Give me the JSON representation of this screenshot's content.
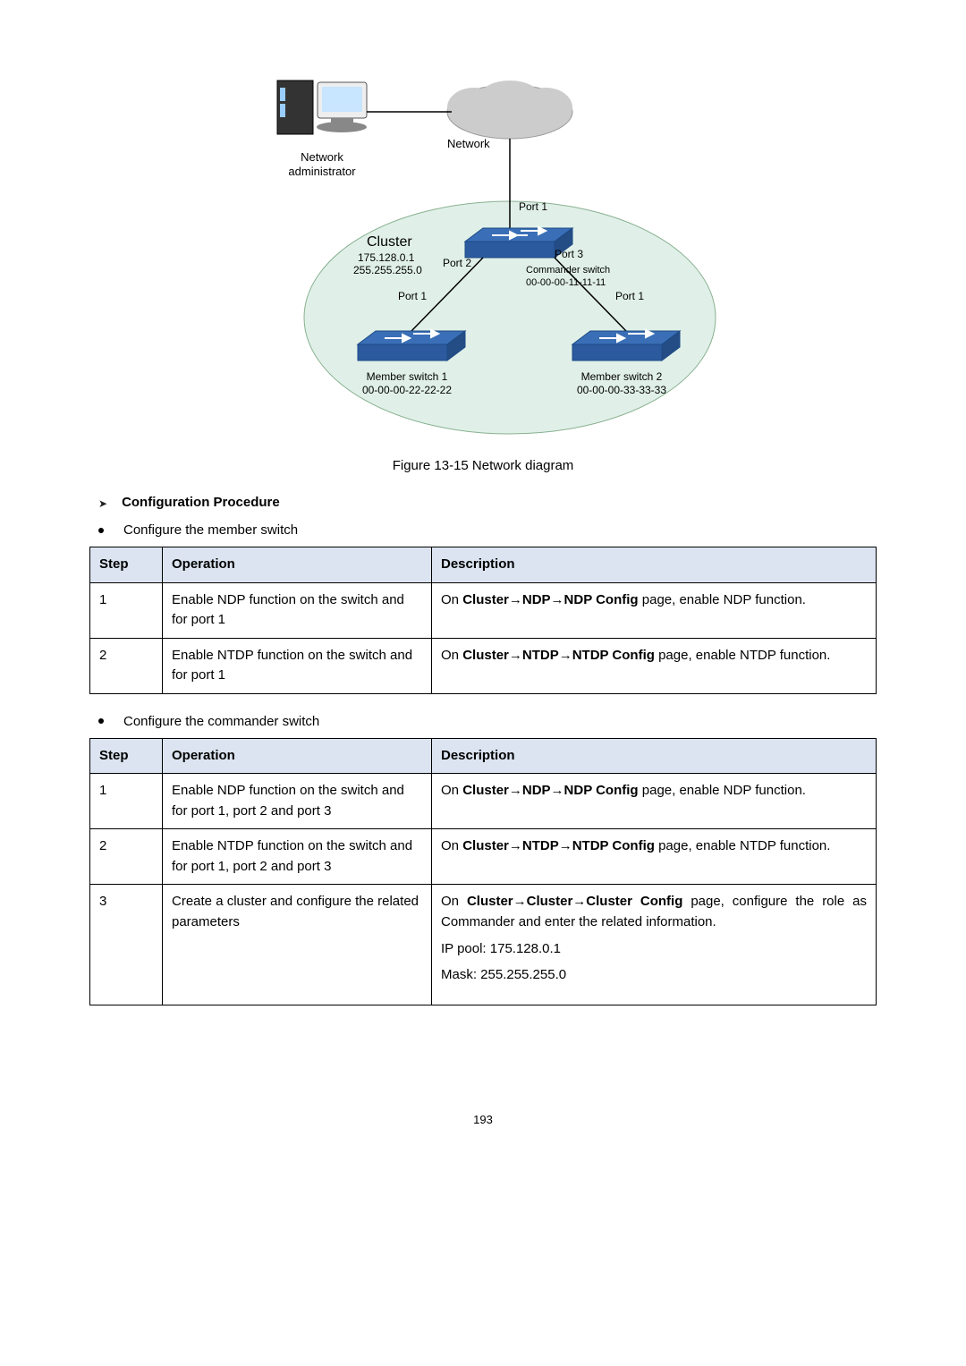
{
  "diagram": {
    "admin_l1": "Network",
    "admin_l2": "administrator",
    "network_label": "Network",
    "cluster_title": "Cluster",
    "cluster_ip": "175.128.0.1",
    "cluster_mask": "255.255.255.0",
    "port1": "Port 1",
    "port2": "Port 2",
    "port3": "Port 3",
    "port1_l": "Port 1",
    "port1_r": "Port 1",
    "commander_l1": "Commander switch",
    "commander_l2": "00-00-00-11-11-11",
    "member1_l1": "Member switch 1",
    "member1_l2": "00-00-00-22-22-22",
    "member2_l1": "Member switch 2",
    "member2_l2": "00-00-00-33-33-33"
  },
  "figure_caption": "Figure 13-15 Network diagram",
  "section_title": "Configuration Procedure",
  "bullet_member": "Configure the member switch",
  "bullet_commander": "Configure the commander switch",
  "headers": {
    "step": "Step",
    "operation": "Operation",
    "description": "Description"
  },
  "table_member": {
    "rows": [
      {
        "step": "1",
        "op": "Enable NDP function on the switch and for port 1",
        "desc_pre": "On ",
        "desc_bold": "Cluster→NDP→NDP Config",
        "desc_post": " page, enable NDP function."
      },
      {
        "step": "2",
        "op": "Enable NTDP function on the switch and for port 1",
        "desc_pre": "On ",
        "desc_bold": "Cluster→NTDP→NTDP Config",
        "desc_post": " page, enable NTDP function."
      }
    ]
  },
  "table_commander": {
    "rows": [
      {
        "step": "1",
        "op": "Enable NDP function on the switch and for port 1, port 2 and port 3",
        "desc_pre": "On ",
        "desc_bold": "Cluster→NDP→NDP Config",
        "desc_post": " page, enable NDP function."
      },
      {
        "step": "2",
        "op": "Enable NTDP function on the switch and for port 1, port 2 and port 3",
        "desc_pre": "On ",
        "desc_bold": "Cluster→NTDP→NTDP Config",
        "desc_post": " page, enable NTDP function."
      },
      {
        "step": "3",
        "op": "Create a cluster and configure the related parameters",
        "desc_pre": "On ",
        "desc_bold": "Cluster→Cluster→Cluster Config",
        "desc_post": " page, configure the role as Commander and enter the related information.",
        "ip_line": "IP pool: 175.128.0.1",
        "mask_line": "Mask: 255.255.255.0"
      }
    ]
  },
  "page_number": "193"
}
